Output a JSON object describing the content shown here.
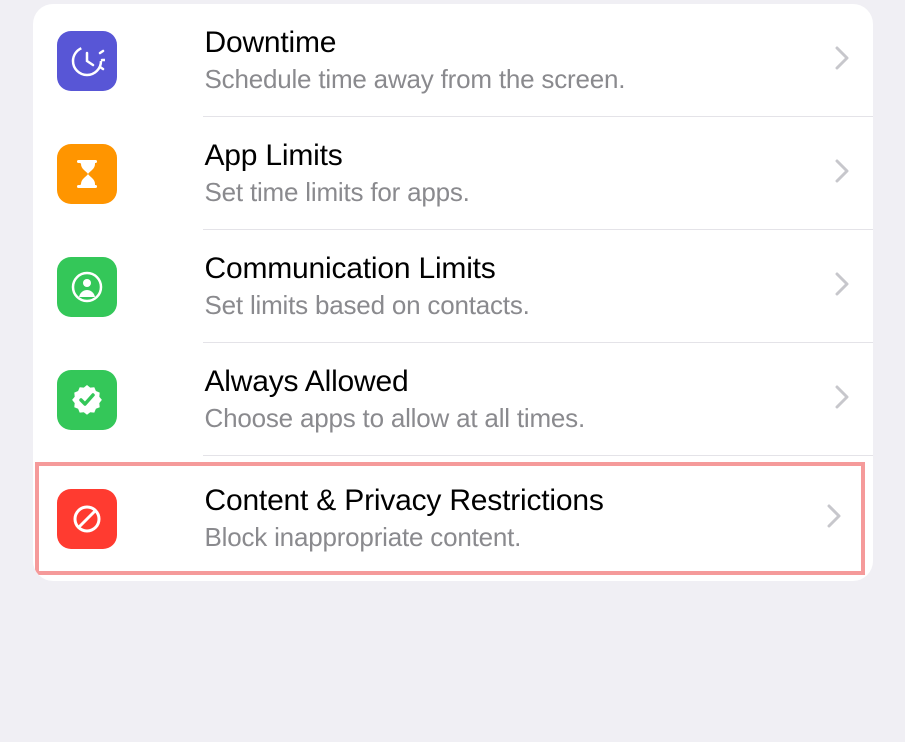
{
  "settings": {
    "items": [
      {
        "title": "Downtime",
        "subtitle": "Schedule time away from the screen.",
        "icon": "downtime-icon",
        "color": "purple"
      },
      {
        "title": "App Limits",
        "subtitle": "Set time limits for apps.",
        "icon": "hourglass-icon",
        "color": "orange"
      },
      {
        "title": "Communication Limits",
        "subtitle": "Set limits based on contacts.",
        "icon": "contact-icon",
        "color": "green"
      },
      {
        "title": "Always Allowed",
        "subtitle": "Choose apps to allow at all times.",
        "icon": "verified-check-icon",
        "color": "green"
      },
      {
        "title": "Content & Privacy Restrictions",
        "subtitle": "Block inappropriate content.",
        "icon": "no-entry-icon",
        "color": "red",
        "highlighted": true
      }
    ]
  }
}
